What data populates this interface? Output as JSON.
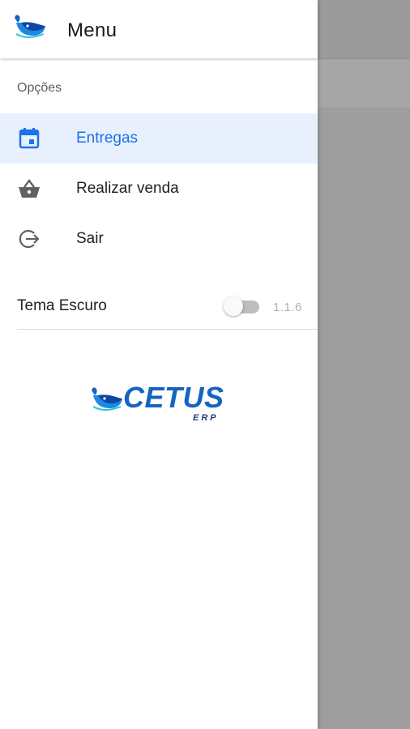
{
  "header": {
    "title": "Menu",
    "logo_icon": "whale-logo-icon"
  },
  "section": {
    "title": "Opções"
  },
  "menu": {
    "items": [
      {
        "label": "Entregas",
        "icon": "calendar-icon",
        "active": true
      },
      {
        "label": "Realizar venda",
        "icon": "shopping-basket-icon",
        "active": false
      },
      {
        "label": "Sair",
        "icon": "logout-icon",
        "active": false
      }
    ]
  },
  "theme": {
    "label": "Tema Escuro",
    "enabled": false
  },
  "version": "1.1.6",
  "brand": {
    "name": "CETUS",
    "sub": "ERP",
    "logo_icon": "whale-logo-icon"
  },
  "colors": {
    "accent": "#1a73e8",
    "active_bg": "#e8f0fe",
    "brand": "#1565c0",
    "scrim": "#9e9e9e"
  }
}
